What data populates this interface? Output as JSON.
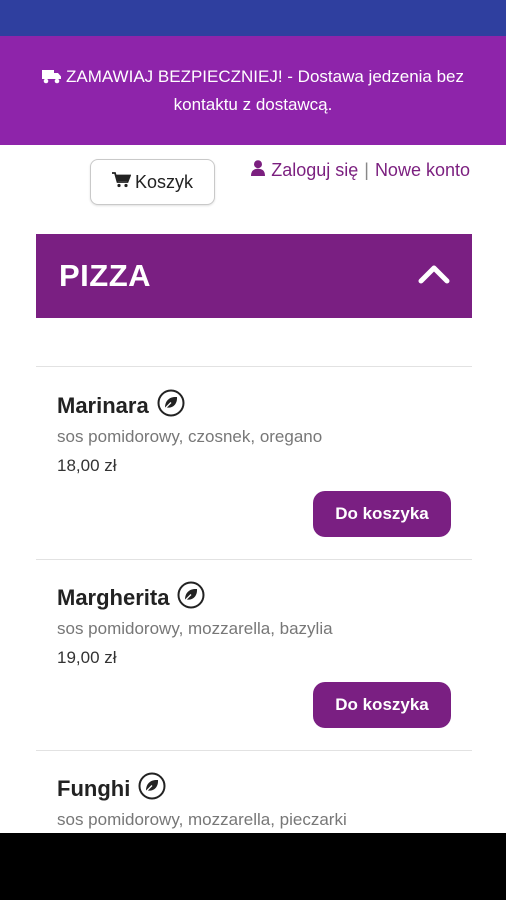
{
  "banner": {
    "text": "ZAMAWIAJ BEZPIECZNIEJ! - Dostawa jedzenia bez kontaktu z dostawcą."
  },
  "header": {
    "cart_label": "Koszyk",
    "login_label": "Zaloguj się",
    "separator": "|",
    "register_label": "Nowe konto"
  },
  "category": {
    "title": "PIZZA"
  },
  "products": [
    {
      "name": "Marinara",
      "description": "sos pomidorowy, czosnek, oregano",
      "price": "18,00 zł",
      "button": "Do koszyka"
    },
    {
      "name": "Margherita",
      "description": "sos pomidorowy, mozzarella, bazylia",
      "price": "19,00 zł",
      "button": "Do koszyka"
    },
    {
      "name": "Funghi",
      "description": "sos pomidorowy, mozzarella, pieczarki"
    }
  ],
  "icons": {
    "banner": "truck-icon",
    "cart": "cart-icon",
    "user": "user-icon",
    "collapse": "chevron-up-icon",
    "vegetarian": "leaf-icon"
  },
  "colors": {
    "status_bar": "#2f3f9f",
    "banner": "#8e24aa",
    "accent": "#7a1f82",
    "link": "#7b1f7f"
  }
}
